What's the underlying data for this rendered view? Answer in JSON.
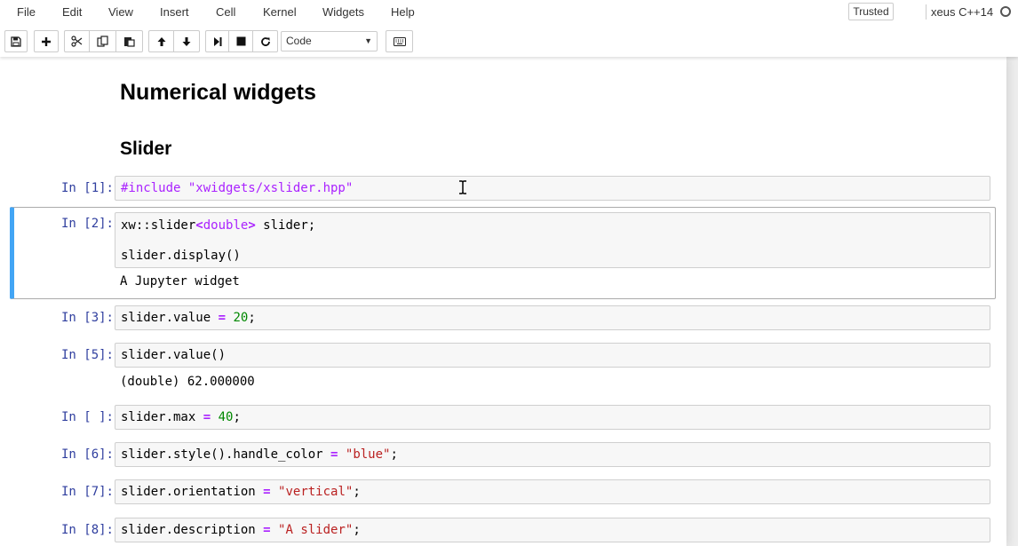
{
  "menu": [
    "File",
    "Edit",
    "View",
    "Insert",
    "Cell",
    "Kernel",
    "Widgets",
    "Help"
  ],
  "trusted_label": "Trusted",
  "kernel_name": "xeus C++14",
  "cell_type": "Code",
  "icons": {
    "save": "floppy-disk-icon",
    "insert": "plus-icon",
    "cut": "scissors-icon",
    "copy": "copy-icon",
    "paste": "paste-icon",
    "up": "arrow-up-icon",
    "down": "arrow-down-icon",
    "run": "step-forward-icon",
    "stop": "stop-icon",
    "restart": "refresh-icon",
    "palette": "keyboard-icon"
  },
  "headings": {
    "h1": "Numerical widgets",
    "h2": "Slider"
  },
  "cells": [
    {
      "prompt": "In [1]:",
      "code": [
        "#include \"xwidgets/xslider.hpp\""
      ],
      "output": ""
    },
    {
      "prompt": "In [2]:",
      "code": [
        "xw::slider<double> slider;",
        "",
        "slider.display()"
      ],
      "output": "A Jupyter widget"
    },
    {
      "prompt": "In [3]:",
      "code": [
        "slider.value = 20;"
      ],
      "output": ""
    },
    {
      "prompt": "In [5]:",
      "code": [
        "slider.value()"
      ],
      "output": "(double) 62.000000"
    },
    {
      "prompt": "In [ ]:",
      "code": [
        "slider.max = 40;"
      ],
      "output": ""
    },
    {
      "prompt": "In [6]:",
      "code": [
        "slider.style().handle_color = \"blue\";"
      ],
      "output": ""
    },
    {
      "prompt": "In [7]:",
      "code": [
        "slider.orientation = \"vertical\";"
      ],
      "output": ""
    },
    {
      "prompt": "In [8]:",
      "code": [
        "slider.description = \"A slider\";"
      ],
      "output": ""
    }
  ],
  "colors": {
    "prompt": "#303f9f",
    "selected_border": "#42a5f5",
    "keyword": "#aa22ff",
    "number": "#008800",
    "string": "#ba2121"
  }
}
